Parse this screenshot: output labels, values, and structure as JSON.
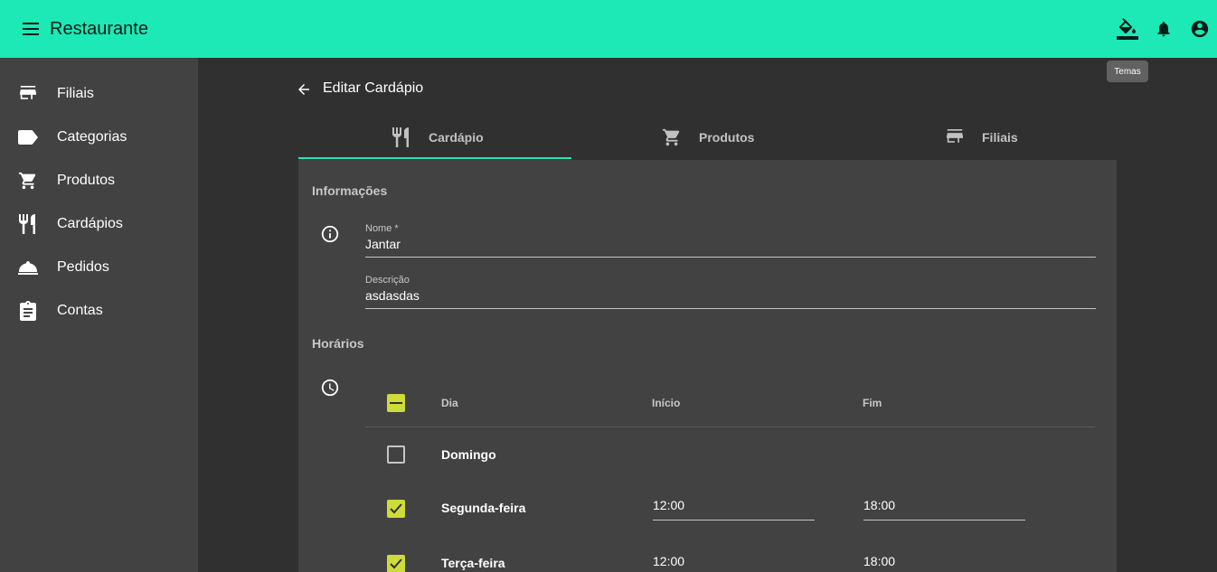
{
  "app": {
    "title": "Restaurante",
    "tooltip": "Temas",
    "accent": "#1de9b6",
    "checkbox_color": "#cddc39"
  },
  "header_actions": [
    {
      "icon": "format-color-fill-icon"
    },
    {
      "icon": "bell-icon"
    },
    {
      "icon": "account-circle-icon"
    }
  ],
  "sidebar": {
    "items": [
      {
        "label": "Filiais",
        "icon": "store-icon"
      },
      {
        "label": "Categorias",
        "icon": "label-icon"
      },
      {
        "label": "Produtos",
        "icon": "cart-icon"
      },
      {
        "label": "Cardápios",
        "icon": "restaurant-icon"
      },
      {
        "label": "Pedidos",
        "icon": "room-service-icon"
      },
      {
        "label": "Contas",
        "icon": "clipboard-icon"
      }
    ]
  },
  "page": {
    "title": "Editar Cardápio"
  },
  "tabs": [
    {
      "label": "Cardápio",
      "icon": "restaurant-icon",
      "active": true
    },
    {
      "label": "Produtos",
      "icon": "cart-icon",
      "active": false
    },
    {
      "label": "Filiais",
      "icon": "store-icon",
      "active": false
    }
  ],
  "info": {
    "section_title": "Informações",
    "name_label": "Nome *",
    "name_value": "Jantar",
    "desc_label": "Descrição",
    "desc_value": "asdasdas"
  },
  "schedule": {
    "section_title": "Horários",
    "columns": {
      "day": "Dia",
      "start": "Início",
      "end": "Fim"
    },
    "header_checkbox": "indeterminate",
    "rows": [
      {
        "day": "Domingo",
        "checked": false,
        "start": "",
        "end": ""
      },
      {
        "day": "Segunda-feira",
        "checked": true,
        "start": "12:00",
        "end": "18:00"
      },
      {
        "day": "Terça-feira",
        "checked": true,
        "start": "12:00",
        "end": "18:00"
      }
    ]
  }
}
